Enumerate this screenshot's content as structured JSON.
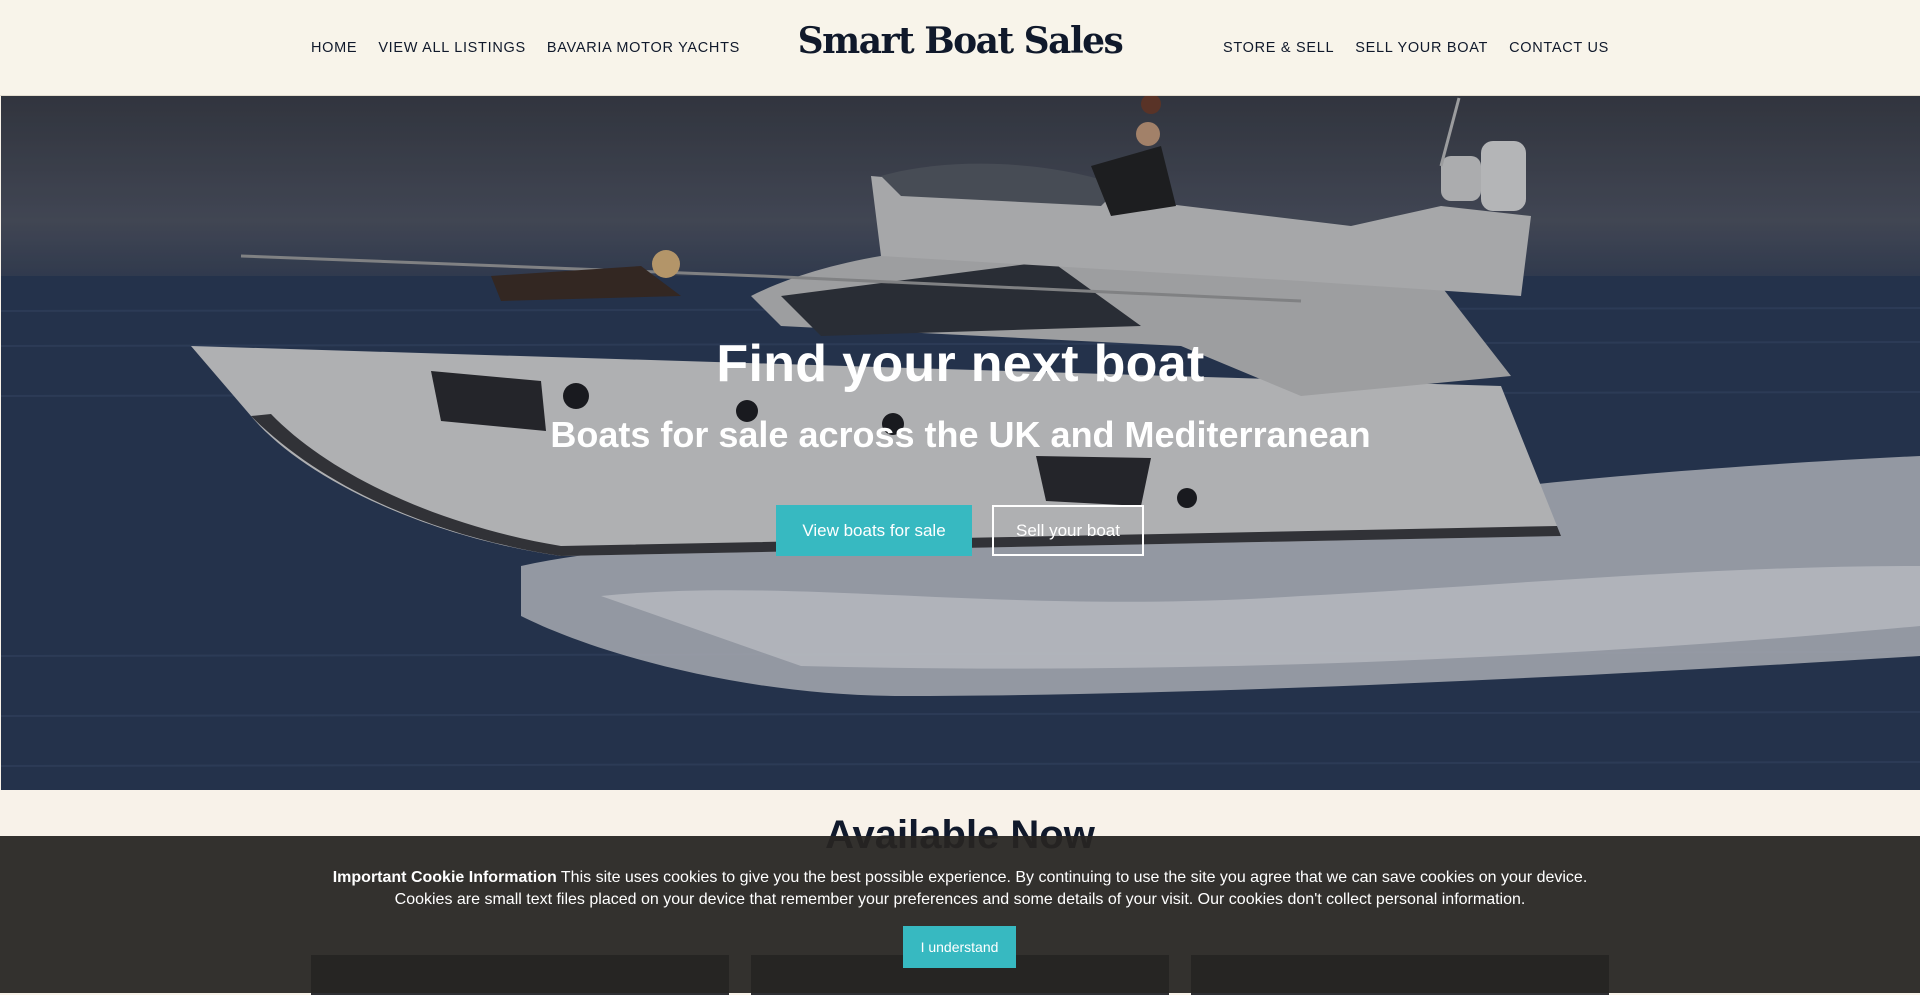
{
  "header": {
    "logo": "Smart Boat Sales",
    "nav_left": [
      "HOME",
      "VIEW ALL LISTINGS",
      "BAVARIA MOTOR YACHTS"
    ],
    "nav_right": [
      "STORE & SELL",
      "SELL YOUR BOAT",
      "CONTACT US"
    ]
  },
  "hero": {
    "title": "Find your next boat",
    "subtitle": "Boats for sale across the UK and Mediterranean",
    "primary_button": "View boats for sale",
    "secondary_button": "Sell your boat",
    "image_icon": "motor-yacht-photo"
  },
  "section": {
    "title": "Available Now"
  },
  "cookie_banner": {
    "heading": "Important Cookie Information",
    "body": " This site uses cookies to give you the best possible experience. By continuing to use the site you agree that we can save cookies on your device. Cookies are small text files placed on your device that remember your preferences and some details of your visit. Our cookies don't collect personal information.",
    "button": "I understand"
  },
  "colors": {
    "accent": "#37b9c1",
    "page_background": "#f8f2e9",
    "text_dark": "#10192b",
    "cookie_background": "#262422"
  }
}
